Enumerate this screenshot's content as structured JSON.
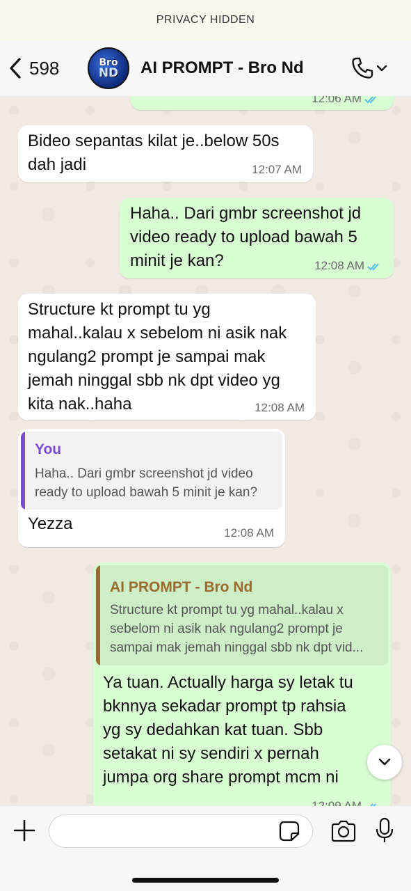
{
  "status_bar": {
    "privacy_label": "PRIVACY HIDDEN"
  },
  "header": {
    "back_count": "598",
    "contact_name": "AI PROMPT - Bro Nd",
    "avatar_line1": "Bro",
    "avatar_line2": "ND"
  },
  "messages": [
    {
      "id": "m0",
      "direction": "out",
      "time": "12:06 AM",
      "read": true
    },
    {
      "id": "m1",
      "direction": "in",
      "lines": [
        "Bideo sepantas kilat je..below 50s",
        "dah jadi"
      ],
      "time": "12:07 AM"
    },
    {
      "id": "m2",
      "direction": "out",
      "lines": [
        "Haha.. Dari gmbr screenshot jd",
        "video ready to upload bawah 5",
        "minit je kan?"
      ],
      "time": "12:08 AM",
      "read": true
    },
    {
      "id": "m3",
      "direction": "in",
      "lines": [
        "Structure kt prompt tu yg",
        "mahal..kalau x sebelom ni asik nak",
        "ngulang2 prompt je sampai mak",
        "jemah ninggal sbb nk dpt video yg",
        "kita nak..haha"
      ],
      "time": "12:08 AM"
    },
    {
      "id": "m4",
      "direction": "in",
      "quote": {
        "author": "You",
        "lines": [
          "Haha.. Dari gmbr screenshot jd video",
          "ready to upload bawah 5 minit je kan?"
        ]
      },
      "lines": [
        "Yezza"
      ],
      "time": "12:08 AM"
    },
    {
      "id": "m5",
      "direction": "out",
      "quote": {
        "author": "AI PROMPT - Bro Nd",
        "lines": [
          "Structure kt prompt tu yg mahal..kalau x",
          "sebelom ni asik nak ngulang2 prompt je",
          "sampai mak jemah ninggal sbb nk dpt vid..."
        ]
      },
      "lines": [
        "Ya tuan. Actually harga sy letak tu",
        "bknnya sekadar prompt tp rahsia",
        "yg sy dedahkan kat tuan. Sbb",
        "setakat ni sy sendiri x pernah",
        "jumpa org share prompt mcm ni"
      ],
      "time": "12:09 AM",
      "read": true
    }
  ],
  "composer": {
    "placeholder": ""
  },
  "colors": {
    "incoming": "#ffffff",
    "outgoing": "#d9fdd3",
    "read_ticks": "#53bdeb",
    "quote_you": "#7c4dcc",
    "quote_contact": "#9a6a2e"
  },
  "icons": [
    "chevron-left-icon",
    "phone-icon",
    "chevron-down-icon",
    "plus-icon",
    "sticker-icon",
    "camera-icon",
    "microphone-icon"
  ]
}
